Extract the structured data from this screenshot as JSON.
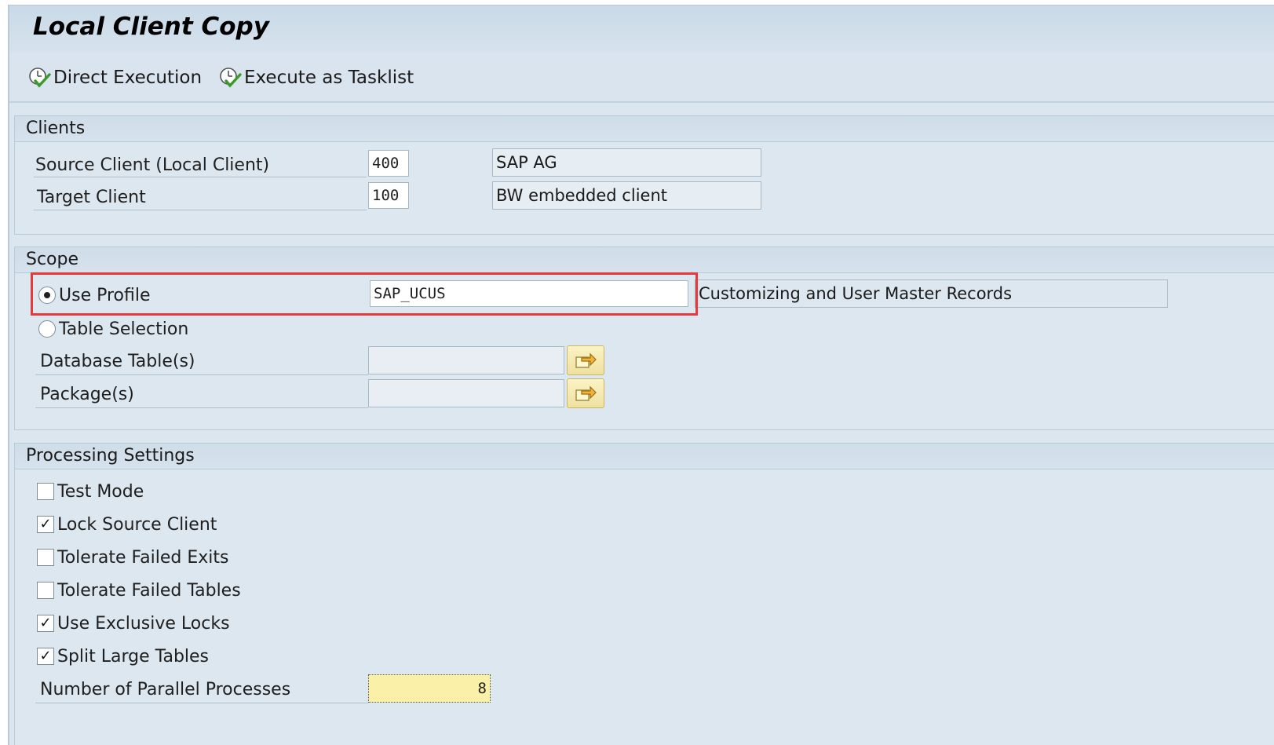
{
  "window": {
    "title": "Local Client Copy"
  },
  "toolbar": {
    "direct_execution": "Direct Execution",
    "execute_tasklist": "Execute as Tasklist"
  },
  "clients": {
    "header": "Clients",
    "source_label": "Source Client (Local Client)",
    "source_value": "400",
    "source_desc": "SAP AG",
    "target_label": "Target Client",
    "target_value": "100",
    "target_desc": "BW embedded client"
  },
  "scope": {
    "header": "Scope",
    "use_profile_label": "Use Profile",
    "use_profile_selected": true,
    "profile_value": "SAP_UCUS",
    "profile_desc": "Customizing and User Master Records",
    "table_selection_label": "Table Selection",
    "table_selection_selected": false,
    "db_tables_label": "Database Table(s)",
    "db_tables_value": "",
    "packages_label": "Package(s)",
    "packages_value": ""
  },
  "processing": {
    "header": "Processing Settings",
    "options": [
      {
        "label": "Test Mode",
        "checked": false
      },
      {
        "label": "Lock Source Client",
        "checked": true
      },
      {
        "label": "Tolerate Failed Exits",
        "checked": false
      },
      {
        "label": "Tolerate Failed Tables",
        "checked": false
      },
      {
        "label": "Use Exclusive Locks",
        "checked": true
      },
      {
        "label": "Split Large Tables",
        "checked": true
      }
    ],
    "parallel_label": "Number of Parallel Processes",
    "parallel_value": "8"
  },
  "colors": {
    "highlight": "#e8383d",
    "select_button": "#f6ebb4",
    "focused_field": "#fbf0a8"
  },
  "icons": {
    "execute": "execute-clock-check-icon",
    "select": "multiple-selection-arrow-icon"
  }
}
